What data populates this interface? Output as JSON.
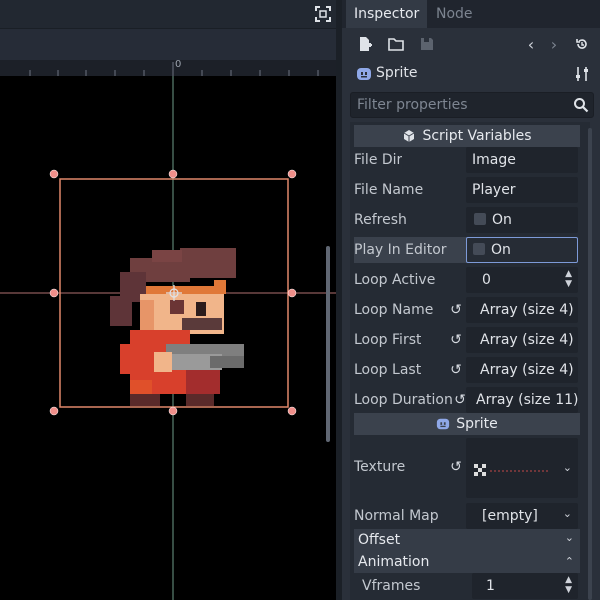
{
  "tabs": {
    "inspector": "Inspector",
    "node": "Node"
  },
  "object": {
    "name": "Sprite"
  },
  "filter": {
    "placeholder": "Filter properties"
  },
  "ruler": {
    "origin_label": "0"
  },
  "script_variables": {
    "title": "Script Variables",
    "rows": [
      {
        "label": "File Dir",
        "value": "Image"
      },
      {
        "label": "File Name",
        "value": "Player"
      },
      {
        "label": "Refresh",
        "value": "On"
      },
      {
        "label": "Play In Editor",
        "value": "On"
      },
      {
        "label": "Loop Active",
        "value": "0"
      },
      {
        "label": "Loop Name",
        "value": "Array (size 4)"
      },
      {
        "label": "Loop First",
        "value": "Array (size 4)"
      },
      {
        "label": "Loop Last",
        "value": "Array (size 4)"
      },
      {
        "label": "Loop Duration",
        "value": "Array (size 11)"
      }
    ]
  },
  "sprite_section": {
    "title": "Sprite",
    "texture_label": "Texture",
    "normal_map_label": "Normal Map",
    "normal_map_value": "[empty]",
    "offset_label": "Offset",
    "animation_label": "Animation",
    "vframes_label": "Vframes",
    "vframes_value": "1"
  },
  "colors": {
    "selection": "#e0876a",
    "accent": "#6f8fd6",
    "background": "#2a303a"
  }
}
